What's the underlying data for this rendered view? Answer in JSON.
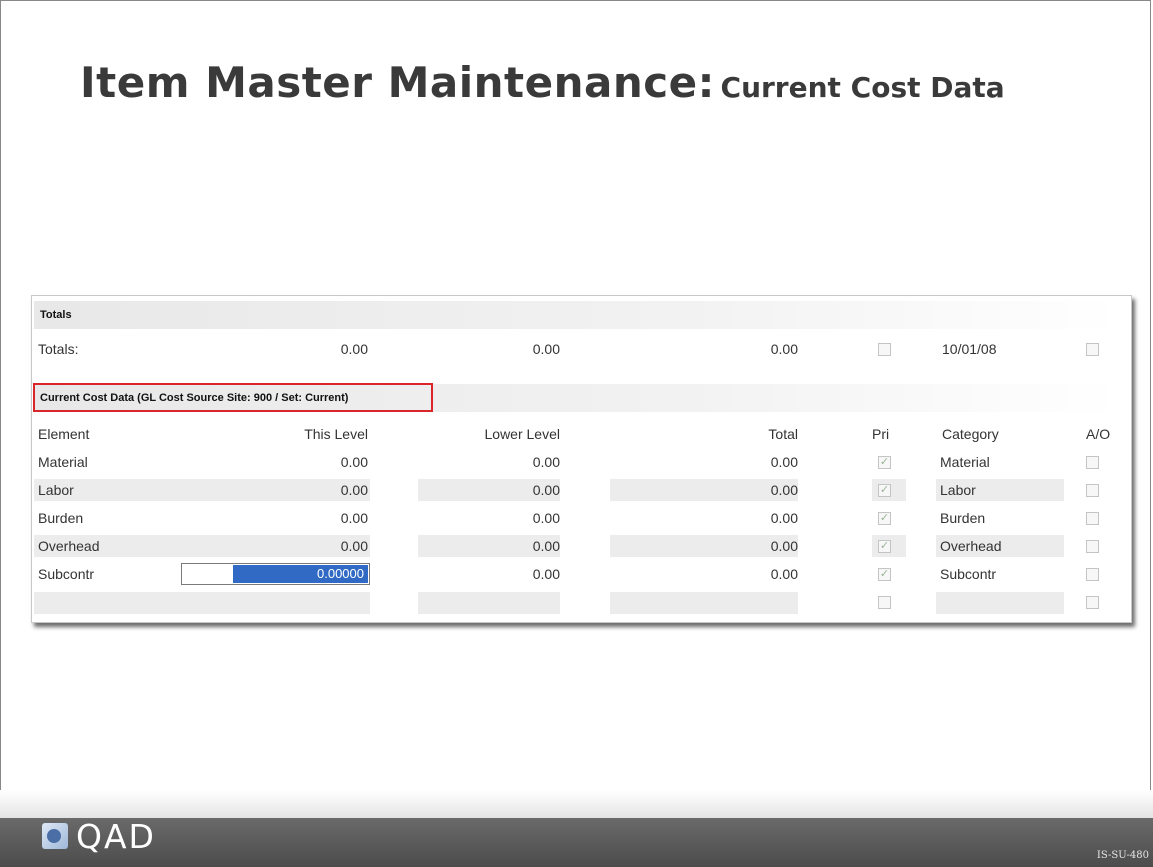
{
  "slide": {
    "title_main": "Item Master Maintenance:",
    "title_sub": "Current Cost Data",
    "code": "IS-SU-480"
  },
  "totals_section": {
    "header": "Totals",
    "label": "Totals:",
    "this_level": "0.00",
    "lower_level": "0.00",
    "total": "0.00",
    "date": "10/01/08"
  },
  "cost_section": {
    "header": "Current Cost Data (GL Cost Source Site: 900 / Set: Current)",
    "columns": {
      "element": "Element",
      "this_level": "This Level",
      "lower_level": "Lower Level",
      "total": "Total",
      "pri": "Pri",
      "category": "Category",
      "ao": "A/O"
    },
    "rows": [
      {
        "element": "Material",
        "this_level": "0.00",
        "lower_level": "0.00",
        "total": "0.00",
        "category": "Material"
      },
      {
        "element": "Labor",
        "this_level": "0.00",
        "lower_level": "0.00",
        "total": "0.00",
        "category": "Labor"
      },
      {
        "element": "Burden",
        "this_level": "0.00",
        "lower_level": "0.00",
        "total": "0.00",
        "category": "Burden"
      },
      {
        "element": "Overhead",
        "this_level": "0.00",
        "lower_level": "0.00",
        "total": "0.00",
        "category": "Overhead"
      },
      {
        "element": "Subcontr",
        "this_level": "0.00000",
        "lower_level": "0.00",
        "total": "0.00",
        "category": "Subcontr"
      }
    ]
  },
  "footer": {
    "logo_text": "QAD"
  },
  "colors": {
    "highlight_border": "#d9262b",
    "selection": "#316ac5",
    "footer": "#555555"
  }
}
